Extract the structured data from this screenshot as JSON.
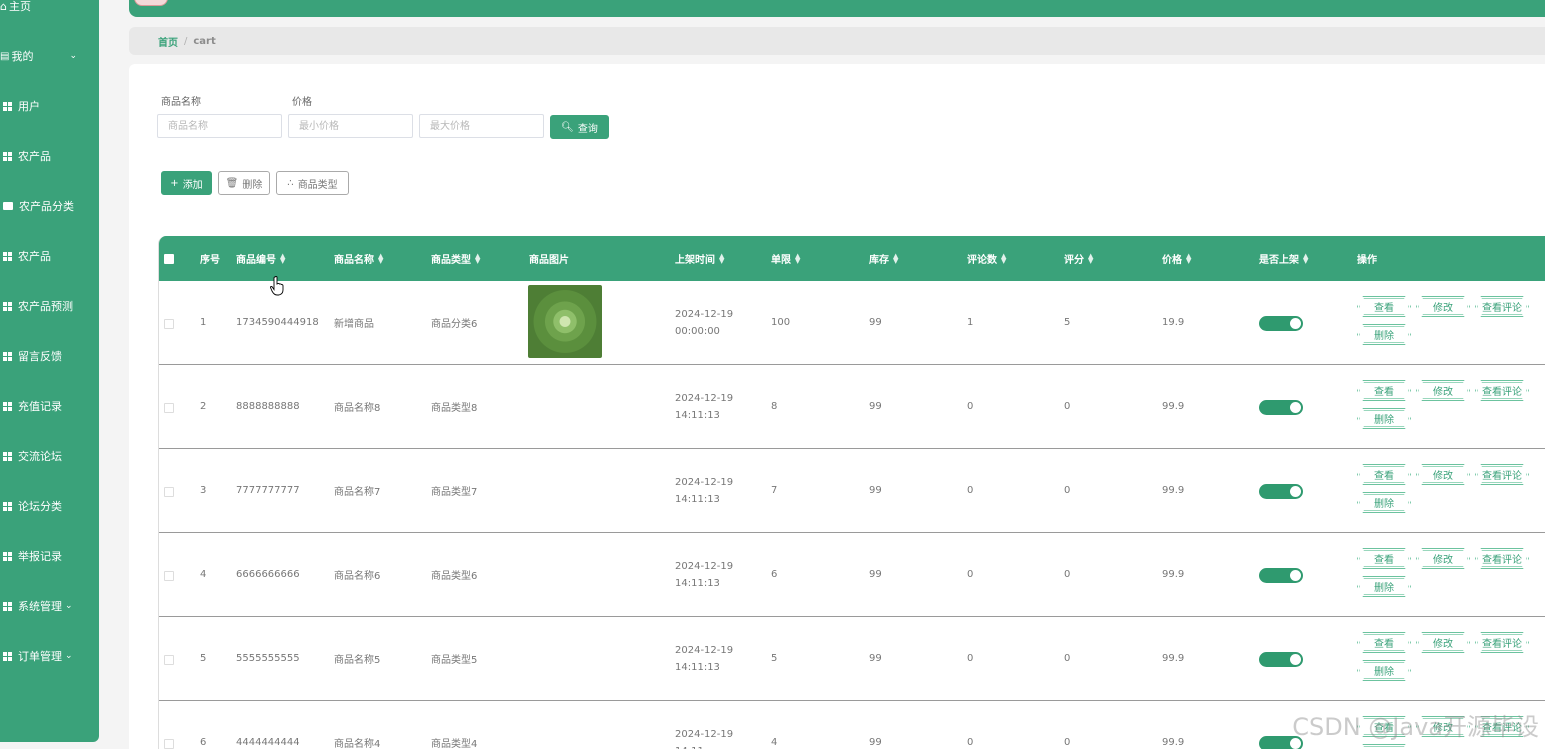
{
  "sidebar": {
    "items": [
      {
        "label": "主页",
        "icon": "home-icon"
      },
      {
        "label": "我的",
        "icon": "calendar-icon",
        "expand": "⌄"
      },
      {
        "label": "用户",
        "icon": "grid-icon"
      },
      {
        "label": "农产品",
        "icon": "grid-icon"
      },
      {
        "label": "农产品分类",
        "icon": "monitor-icon"
      },
      {
        "label": "农产品",
        "icon": "sale-icon"
      },
      {
        "label": "农产品预测",
        "icon": "grid-icon"
      },
      {
        "label": "留言反馈",
        "icon": "grid-icon"
      },
      {
        "label": "充值记录",
        "icon": "grid-icon"
      },
      {
        "label": "交流论坛",
        "icon": "grid-icon"
      },
      {
        "label": "论坛分类",
        "icon": "grid-icon"
      },
      {
        "label": "举报记录",
        "icon": "grid-icon"
      },
      {
        "label": "系统管理",
        "icon": "document-icon",
        "expand": "⌄"
      },
      {
        "label": "订单管理",
        "icon": "grid-icon",
        "expand": "⌄"
      }
    ]
  },
  "breadcrumb": {
    "home": "首页",
    "separator": "/",
    "current": "cart"
  },
  "search": {
    "name_label": "商品名称",
    "name_placeholder": "商品名称",
    "price_label": "价格",
    "min_placeholder": "最小价格",
    "max_placeholder": "最大价格",
    "query_button": "查询"
  },
  "actions": {
    "add": "添加",
    "delete": "删除",
    "category": "商品类型"
  },
  "table": {
    "columns": [
      "序号",
      "商品编号",
      "商品名称",
      "商品类型",
      "商品图片",
      "上架时间",
      "单限",
      "库存",
      "评论数",
      "评分",
      "价格",
      "是否上架",
      "操作"
    ],
    "rows": [
      {
        "idx": "1",
        "code": "1734590444918",
        "name": "新增商品",
        "type": "商品分类6",
        "time": "2024-12-19 00:00:00",
        "limit": "100",
        "stock": "99",
        "comments": "1",
        "score": "5",
        "price": "19.9",
        "has_image": true
      },
      {
        "idx": "2",
        "code": "8888888888",
        "name": "商品名称8",
        "type": "商品类型8",
        "time": "2024-12-19 14:11:13",
        "limit": "8",
        "stock": "99",
        "comments": "0",
        "score": "0",
        "price": "99.9"
      },
      {
        "idx": "3",
        "code": "7777777777",
        "name": "商品名称7",
        "type": "商品类型7",
        "time": "2024-12-19 14:11:13",
        "limit": "7",
        "stock": "99",
        "comments": "0",
        "score": "0",
        "price": "99.9"
      },
      {
        "idx": "4",
        "code": "6666666666",
        "name": "商品名称6",
        "type": "商品类型6",
        "time": "2024-12-19 14:11:13",
        "limit": "6",
        "stock": "99",
        "comments": "0",
        "score": "0",
        "price": "99.9"
      },
      {
        "idx": "5",
        "code": "5555555555",
        "name": "商品名称5",
        "type": "商品类型5",
        "time": "2024-12-19 14:11:13",
        "limit": "5",
        "stock": "99",
        "comments": "0",
        "score": "0",
        "price": "99.9"
      },
      {
        "idx": "6",
        "code": "4444444444",
        "name": "商品名称4",
        "type": "商品类型4",
        "time": "2024-12-19 14:11:",
        "limit": "4",
        "stock": "99",
        "comments": "0",
        "score": "0",
        "price": "99.9"
      }
    ],
    "row_ops": [
      "查看",
      "修改",
      "查看评论",
      "删除"
    ]
  },
  "watermark": "CSDN @Java开源毕设",
  "colors": {
    "primary": "#3aa27a",
    "background": "#f4f4f4"
  }
}
